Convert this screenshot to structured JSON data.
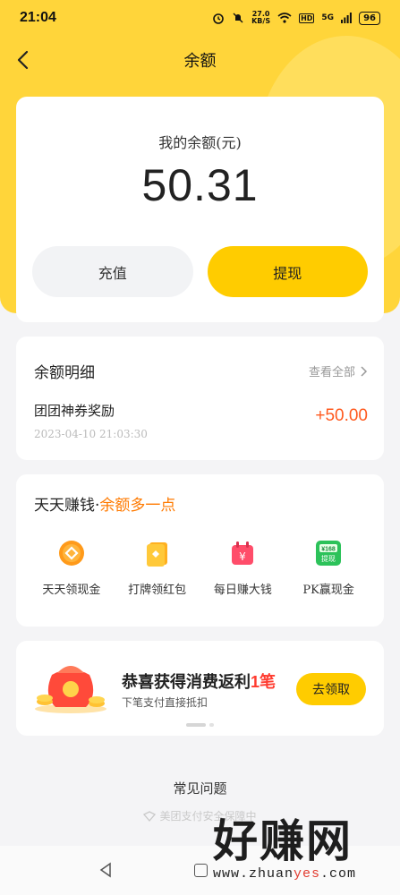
{
  "status_bar": {
    "time": "21:04",
    "net_speed_value": "27.0",
    "net_speed_unit": "KB/S",
    "hd": "HD",
    "signal": "5G",
    "battery": "96"
  },
  "nav": {
    "title": "余额"
  },
  "balance": {
    "label": "我的余额(元)",
    "amount": "50.31",
    "recharge_label": "充值",
    "withdraw_label": "提现"
  },
  "detail": {
    "title": "余额明细",
    "see_all": "查看全部",
    "records": [
      {
        "name": "团团神券奖励",
        "time": "2023-04-10  21:03:30",
        "amount": "+50.00"
      }
    ]
  },
  "earn": {
    "title_prefix": "天天赚钱·",
    "title_emphasis": "余额多一点",
    "items": [
      {
        "label": "天天领现金",
        "icon": "coin-icon"
      },
      {
        "label": "打牌领红包",
        "icon": "card-icon"
      },
      {
        "label": "每日赚大钱",
        "icon": "calendar-icon"
      },
      {
        "label": "PK赢现金",
        "icon": "cash-withdraw-icon",
        "badge_top": "¥168",
        "badge_bottom": "提现"
      }
    ]
  },
  "rebate": {
    "title_main": "恭喜获得消费返利",
    "title_highlight": "1笔",
    "subtitle": "下笔支付直接抵扣",
    "button": "去领取"
  },
  "faq": "常见问题",
  "secure_text": "美团支付安全保障中",
  "watermark": {
    "big": "好赚网",
    "url_prefix": "www.zhuan",
    "url_highlight": "yes",
    "url_suffix": ".com"
  },
  "colors": {
    "brand_yellow": "#ffcc00",
    "amount_orange": "#ff5a1f",
    "highlight_red": "#ff3b2f"
  }
}
